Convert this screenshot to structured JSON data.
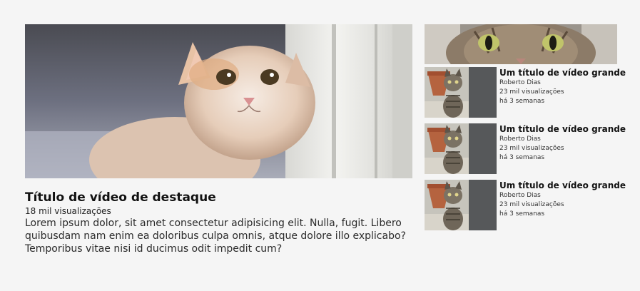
{
  "featured": {
    "thumbnail_icon": "kitten-photo",
    "title": "Título de vídeo de destaque",
    "views": "18 mil visualizações",
    "description": "Lorem ipsum dolor, sit amet consectetur adipisicing elit. Nulla, fugit. Libero quibusdam nam enim ea doloribus culpa omnis, atque dolore illo explicabo? Temporibus vitae nisi id ducimus odit impedit cum?"
  },
  "sidebar": {
    "top_thumbnail_icon": "cat-face-photo",
    "videos": [
      {
        "thumbnail_icon": "tabby-kitten-photo",
        "title": "Um título de vídeo grande",
        "channel": "Roberto Dias",
        "views": "23 mil visualizações",
        "age": "há 3 semanas"
      },
      {
        "thumbnail_icon": "tabby-kitten-photo",
        "title": "Um título de vídeo grande",
        "channel": "Roberto Dias",
        "views": "23 mil visualizações",
        "age": "há 3 semanas"
      },
      {
        "thumbnail_icon": "tabby-kitten-photo",
        "title": "Um título de vídeo grande",
        "channel": "Roberto Dias",
        "views": "23 mil visualizações",
        "age": "há 3 semanas"
      }
    ]
  }
}
